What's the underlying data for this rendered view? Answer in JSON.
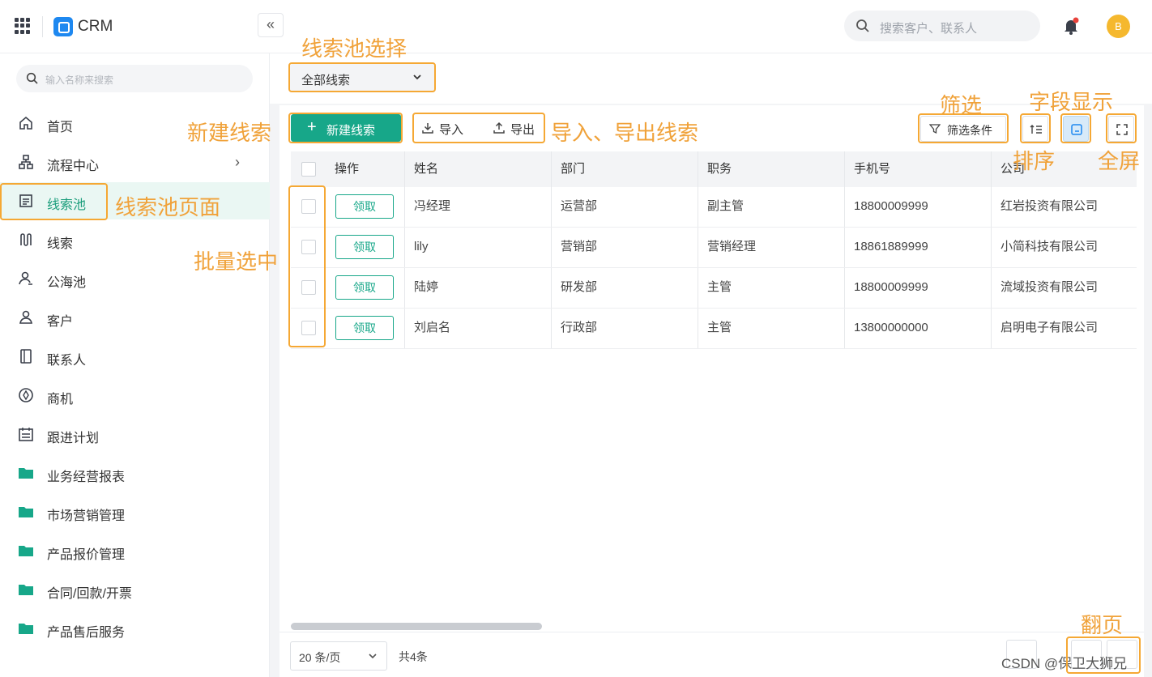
{
  "app": {
    "brand": "CRM",
    "avatar_letter": "B"
  },
  "top_search": {
    "placeholder": "搜索客户、联系人"
  },
  "sidebar": {
    "search_placeholder": "输入名称来搜索",
    "collapse_glyph": "«",
    "items": [
      {
        "label": "首页",
        "icon": "home-icon"
      },
      {
        "label": "流程中心",
        "icon": "flow-icon",
        "has_arrow": true
      },
      {
        "label": "线索池",
        "icon": "leadpool-icon",
        "active": true
      },
      {
        "label": "线索",
        "icon": "lead-icon"
      },
      {
        "label": "公海池",
        "icon": "sea-icon"
      },
      {
        "label": "客户",
        "icon": "customer-icon"
      },
      {
        "label": "联系人",
        "icon": "contact-icon"
      },
      {
        "label": "商机",
        "icon": "opportunity-icon"
      },
      {
        "label": "跟进计划",
        "icon": "calendar-icon"
      },
      {
        "label": "业务经营报表",
        "icon": "folder-icon"
      },
      {
        "label": "市场营销管理",
        "icon": "folder-icon"
      },
      {
        "label": "产品报价管理",
        "icon": "folder-icon"
      },
      {
        "label": "合同/回款/开票",
        "icon": "folder-icon"
      },
      {
        "label": "产品售后服务",
        "icon": "folder-icon"
      }
    ]
  },
  "pool_select": {
    "value": "全部线索"
  },
  "toolbar": {
    "new_lead": "新建线索",
    "import": "导入",
    "export": "导出",
    "filter": "筛选条件"
  },
  "table": {
    "columns": [
      "操作",
      "姓名",
      "部门",
      "职务",
      "手机号",
      "公司"
    ],
    "claim_label": "领取",
    "rows": [
      {
        "name": "冯经理",
        "dept": "运营部",
        "title": "副主管",
        "phone": "18800009999",
        "company": "红岩投资有限公司"
      },
      {
        "name": "lily",
        "dept": "营销部",
        "title": "营销经理",
        "phone": "18861889999",
        "company": "小简科技有限公司"
      },
      {
        "name": "陆婷",
        "dept": "研发部",
        "title": "主管",
        "phone": "18800009999",
        "company": "流域投资有限公司"
      },
      {
        "name": "刘启名",
        "dept": "行政部",
        "title": "主管",
        "phone": "13800000000",
        "company": "启明电子有限公司"
      }
    ]
  },
  "pagination": {
    "page_size": "20 条/页",
    "total": "共4条"
  },
  "annotations": {
    "pool_select": "线索池选择",
    "new_lead": "新建线索",
    "import_export": "导入、导出线索",
    "pool_page": "线索池页面",
    "batch_select": "批量选中",
    "filter": "筛选",
    "fields": "字段显示",
    "sort": "排序",
    "fullscreen": "全屏",
    "paging": "翻页"
  },
  "watermark": "CSDN @保卫大狮兄",
  "colors": {
    "accent": "#17a789",
    "annotation": "#f5a834",
    "avatar": "#f5b82e",
    "logo": "#1e88f0"
  }
}
